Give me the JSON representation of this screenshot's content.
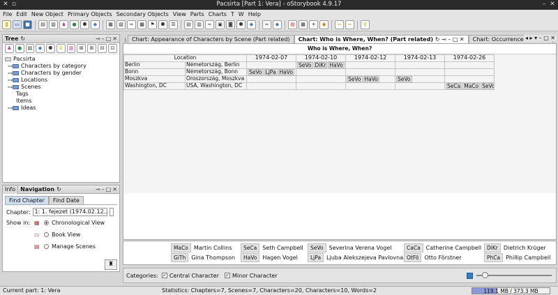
{
  "window": {
    "title": "Pacsirta [Part 1: Vera] - oStorybook 4.9.17"
  },
  "menu": [
    "File",
    "Edit",
    "New Object",
    "Primary Objects",
    "Secondary Objects",
    "View",
    "Parts",
    "Charts",
    "T",
    "W",
    "Help"
  ],
  "tree_panel": {
    "title": "Tree",
    "root": "Pacsirta",
    "items": [
      {
        "label": "Characters by category",
        "folder": true
      },
      {
        "label": "Characters by gender",
        "folder": true
      },
      {
        "label": "Locations",
        "folder": true
      },
      {
        "label": "Scenes",
        "folder": true
      },
      {
        "label": "Tags",
        "folder": false
      },
      {
        "label": "Items",
        "folder": false
      },
      {
        "label": "Ideas",
        "folder": true
      }
    ]
  },
  "nav_panel": {
    "tab_info": "Info",
    "title": "Navigation",
    "subtabs": [
      "Find Chapter",
      "Find Date"
    ],
    "chapter_label": "Chapter:",
    "chapter_value": "1: 1. fejezet (1974.02.12....",
    "show_in_label": "Show in:",
    "options": [
      {
        "label": "Chronological View",
        "selected": true
      },
      {
        "label": "Book View",
        "selected": false
      },
      {
        "label": "Manage Scenes",
        "selected": false
      }
    ]
  },
  "doc_tabs": [
    {
      "label": "Chart: Appearance of Characters by Scene (Part related)",
      "active": false
    },
    {
      "label": "Chart: Who is Where, When? (Part related)",
      "active": true
    },
    {
      "label": "Chart: Occurrence of Locati",
      "active": false
    }
  ],
  "chart": {
    "title": "Who is Where, When?",
    "location_header": "Location",
    "dates": [
      "1974-02-07",
      "1974-02-10",
      "1974-02-12",
      "1974-02-13",
      "1974-02-26"
    ],
    "rows": [
      {
        "name": "Berlin",
        "place": "Németország, Berlin",
        "cells": [
          [],
          [
            "SeVo",
            "DiKr",
            "HaVo"
          ],
          [],
          [],
          []
        ]
      },
      {
        "name": "Bonn",
        "place": "Németország, Bonn",
        "cells": [
          [
            "SeVo",
            "LjPa",
            "HaVo"
          ],
          [],
          [],
          [],
          []
        ]
      },
      {
        "name": "Moszkva",
        "place": "Oroszország, Moszkva",
        "cells": [
          [],
          [],
          [
            "SeVo",
            "HaVo"
          ],
          [
            "SeVo"
          ],
          []
        ]
      },
      {
        "name": "Washington, DC",
        "place": "USA, Washington, DC",
        "cells": [
          [],
          [],
          [],
          [],
          [
            "SeCa",
            "MaCo",
            "SeVo"
          ]
        ]
      }
    ]
  },
  "legend": [
    {
      "code": "MaCo",
      "name": "Martin Collins"
    },
    {
      "code": "SeCa",
      "name": "Seth Campbell"
    },
    {
      "code": "SeVo",
      "name": "Severina Verena Vogel"
    },
    {
      "code": "CaCa",
      "name": "Catherine Campbell"
    },
    {
      "code": "DiKr",
      "name": "Dietrich Krüger"
    },
    {
      "code": "GiTh",
      "name": "Gina Thompson"
    },
    {
      "code": "HaVo",
      "name": "Hagen Vogel"
    },
    {
      "code": "LjPa",
      "name": "Ljuba Alekszejeva Pavlovna"
    },
    {
      "code": "OtFö",
      "name": "Otto Förstner"
    },
    {
      "code": "PhCa",
      "name": "Phillip Campbell"
    }
  ],
  "categories": {
    "label": "Categories:",
    "items": [
      {
        "label": "Central Character",
        "checked": true
      },
      {
        "label": "Minor Character",
        "checked": true
      }
    ]
  },
  "status": {
    "part": "Current part: 1: Vera",
    "stats": "Statistics: Chapters=7,  Scenes=7,  Characters=20,  Characters=10,  Words=2",
    "memory": "119.1 MB / 373.3 MB",
    "memory_fraction": 0.32
  },
  "colors": {
    "titlebar": "#2a2a2a",
    "memory_fill": "#8d99d6",
    "active_tab": "#ffffff"
  }
}
